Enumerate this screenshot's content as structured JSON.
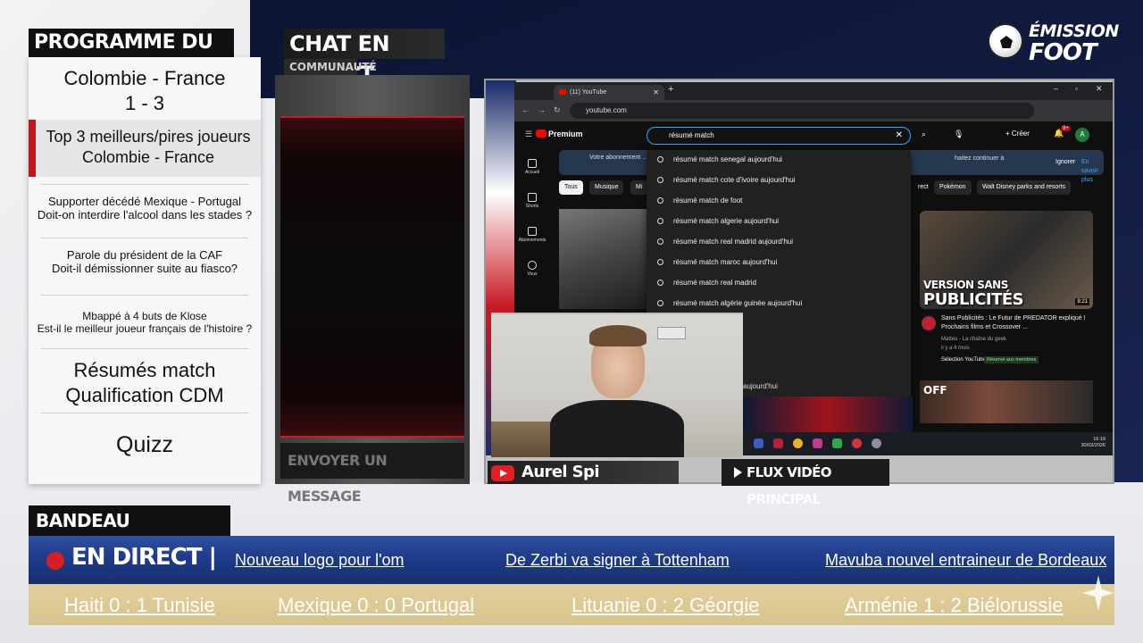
{
  "programme": {
    "title": "PROGRAMME DU JOUR",
    "items": [
      {
        "line1": "Colombie - France",
        "line2": "1 - 3"
      },
      {
        "line1": "Top 3 meilleurs/pires joueurs",
        "line2": "Colombie - France"
      },
      {
        "line1": "Supporter décédé Mexique - Portugal",
        "line2": "Doit-on interdire l'alcool dans les stades ?"
      },
      {
        "line1": "Parole du président de la CAF",
        "line2": "Doit-il démissionner suite au fiasco?"
      },
      {
        "line1": "Mbappé à 4 buts de Klose",
        "line2": "Est-il le meilleur joueur français de l'histoire ?"
      },
      {
        "line1": "Résumés match",
        "line2": "Qualification CDM"
      },
      {
        "line1": "Quizz",
        "line2": ""
      }
    ]
  },
  "chat": {
    "title": "CHAT EN DIRECT",
    "subtitle": "COMMUNAUTÉ",
    "input_placeholder": "ENVOYER UN MESSAGE"
  },
  "logo": {
    "line1": "ÉMISSION",
    "line2": "FOOT"
  },
  "browser": {
    "tab_title": "(11) YouTube",
    "url": "youtube.com",
    "youtube": {
      "brand": "Premium",
      "search_value": "résumé match",
      "create_label": "Créer",
      "notif_badge": "9+",
      "avatar_letter": "A",
      "sidebar": [
        "Accueil",
        "Shorts",
        "Abonnements",
        "Vous"
      ],
      "notice_left": "Votre abonnement ... bénéficier de vos a...",
      "notice_right": "haitez continuer à",
      "notice_ignore": "Ignorer",
      "notice_more": "En savoir plus",
      "chips": [
        "Tous",
        "Musique",
        "Mi",
        "rect",
        "Pokémon",
        "Walt Disney parks and resorts"
      ],
      "suggestions": [
        "résumé match senegal aujourd'hui",
        "résumé match cote d'ivoire aujourd'hui",
        "résumé match de foot",
        "résumé match algerie aujourd'hui",
        "résumé match real madrid aujourd'hui",
        "résumé match maroc aujourd'hui",
        "résumé match real madrid",
        "résumé match algérie guinée aujourd'hui"
      ],
      "partial_suggestion": "aujourd'hui",
      "video": {
        "thumb_text_1": "VERSION SANS",
        "thumb_text_2": "PUBLICITÉS",
        "duration": "9:21",
        "title": "Sans Publicités : Le Futur de PREDATOR expliqué ! Prochains films et Crossover ...",
        "channel": "Matteo - La chaîne du geek",
        "age": "il y a 4 mois",
        "selection": "Sélection YouTube",
        "members": "Réservé aux membres"
      },
      "thumb2_badge": "OFF"
    },
    "taskbar_time": "16:18",
    "taskbar_date": "30/03/2026"
  },
  "webcam": {
    "name": "Aurel Spi"
  },
  "flux_label": "FLUX VIDÉO PRINCIPAL",
  "bandeau": {
    "title": "BANDEAU D'INFORMATION",
    "live": "EN DIRECT |",
    "news": [
      "Nouveau logo pour l'om",
      "De Zerbi va signer à Tottenham",
      "Mavuba nouvel entraineur de Bordeaux"
    ],
    "scores": [
      "Haiti 0 : 1 Tunisie",
      "Mexique 0 : 0 Portugal",
      "Lituanie 0 : 2 Géorgie",
      "Arménie 1 : 2 Biélorussie"
    ]
  },
  "colors": {
    "accent_red": "#c4141c",
    "ticker_blue": "#1d3a86",
    "score_gold": "#d7c38c"
  }
}
